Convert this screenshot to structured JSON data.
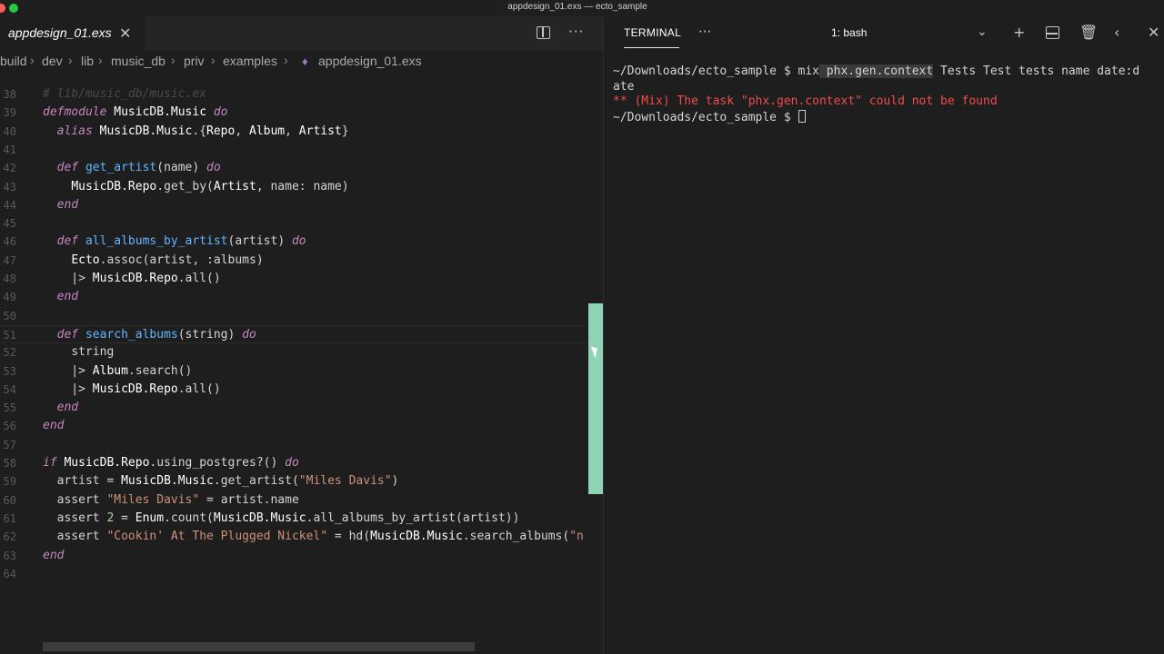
{
  "window": {
    "title": "appdesign_01.exs — ecto_sample"
  },
  "editor": {
    "tab_label": "appdesign_01.exs",
    "close_glyph": "✕",
    "more_glyph": "···",
    "breadcrumb": [
      "build",
      "dev",
      "lib",
      "music_db",
      "priv",
      "examples",
      "appdesign_01.exs"
    ],
    "breadcrumb_sep": "›",
    "file_icon": "elixir-file-icon"
  },
  "terminal": {
    "tab_label": "TERMINAL",
    "more_glyph": "···",
    "shell_select": "1: bash",
    "icons": [
      "add-terminal-icon",
      "split-terminal-icon",
      "trash-icon",
      "chevron-left-icon",
      "close-icon"
    ],
    "lines": {
      "prompt1": "~/Downloads/ecto_sample $ ",
      "cmd_a": "mix",
      "cmd_b": " phx.gen.context",
      "cmd_c": " Tests Test tests name date:d",
      "cmd_wrap": "ate",
      "error": "** (Mix) The task \"phx.gen.context\" could not be found",
      "prompt2": "~/Downloads/ecto_sample $ "
    }
  },
  "code": {
    "lines": [
      {
        "n": "38",
        "t": "# lib/music_db/music.ex"
      },
      {
        "n": "39",
        "t": "defmodule MusicDB.Music do"
      },
      {
        "n": "40",
        "t": "  alias MusicDB.Music.{Repo, Album, Artist}"
      },
      {
        "n": "41",
        "t": ""
      },
      {
        "n": "42",
        "t": "  def get_artist(name) do"
      },
      {
        "n": "43",
        "t": "    MusicDB.Repo.get_by(Artist, name: name)"
      },
      {
        "n": "44",
        "t": "  end"
      },
      {
        "n": "45",
        "t": ""
      },
      {
        "n": "46",
        "t": "  def all_albums_by_artist(artist) do"
      },
      {
        "n": "47",
        "t": "    Ecto.assoc(artist, :albums)"
      },
      {
        "n": "48",
        "t": "    |> MusicDB.Repo.all()"
      },
      {
        "n": "49",
        "t": "  end"
      },
      {
        "n": "50",
        "t": ""
      },
      {
        "n": "51",
        "t": "  def search_albums(string) do"
      },
      {
        "n": "52",
        "t": "    string"
      },
      {
        "n": "53",
        "t": "    |> Album.search()"
      },
      {
        "n": "54",
        "t": "    |> MusicDB.Repo.all()"
      },
      {
        "n": "55",
        "t": "  end"
      },
      {
        "n": "56",
        "t": "end"
      },
      {
        "n": "57",
        "t": ""
      },
      {
        "n": "58",
        "t": "if MusicDB.Repo.using_postgres?() do"
      },
      {
        "n": "59",
        "t": "  artist = MusicDB.Music.get_artist(\"Miles Davis\")"
      },
      {
        "n": "60",
        "t": "  assert \"Miles Davis\" = artist.name"
      },
      {
        "n": "61",
        "t": "  assert 2 = Enum.count(MusicDB.Music.all_albums_by_artist(artist))"
      },
      {
        "n": "62",
        "t": "  assert \"Cookin' At The Plugged Nickel\" = hd(MusicDB.Music.search_albums(\"n"
      },
      {
        "n": "63",
        "t": "end"
      },
      {
        "n": "64",
        "t": ""
      }
    ]
  }
}
